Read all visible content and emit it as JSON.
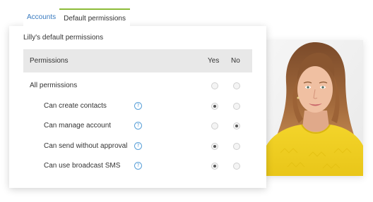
{
  "tabs": [
    {
      "label": "Accounts",
      "active": false
    },
    {
      "label": "Default permissions",
      "active": true
    }
  ],
  "card": {
    "title": "Lilly's default permissions"
  },
  "table": {
    "headers": {
      "permissions": "Permissions",
      "yes": "Yes",
      "no": "No"
    },
    "rows": [
      {
        "label": "All permissions",
        "group": true,
        "help": false,
        "value": null
      },
      {
        "label": "Can create contacts",
        "group": false,
        "help": true,
        "value": "yes"
      },
      {
        "label": "Can manage account",
        "group": false,
        "help": true,
        "value": "no"
      },
      {
        "label": "Can send without approval",
        "group": false,
        "help": true,
        "value": "yes"
      },
      {
        "label": "Can use broadcast SMS",
        "group": false,
        "help": true,
        "value": "yes"
      }
    ]
  },
  "help_icon_glyph": "?",
  "colors": {
    "accent_link": "#3a7bc0",
    "tab_underline": "#8cbb38",
    "help_icon": "#5aa0d8",
    "header_bg": "#e8e8e8"
  },
  "icons": {
    "help": "question-circle-icon",
    "photo": "user-photo"
  }
}
